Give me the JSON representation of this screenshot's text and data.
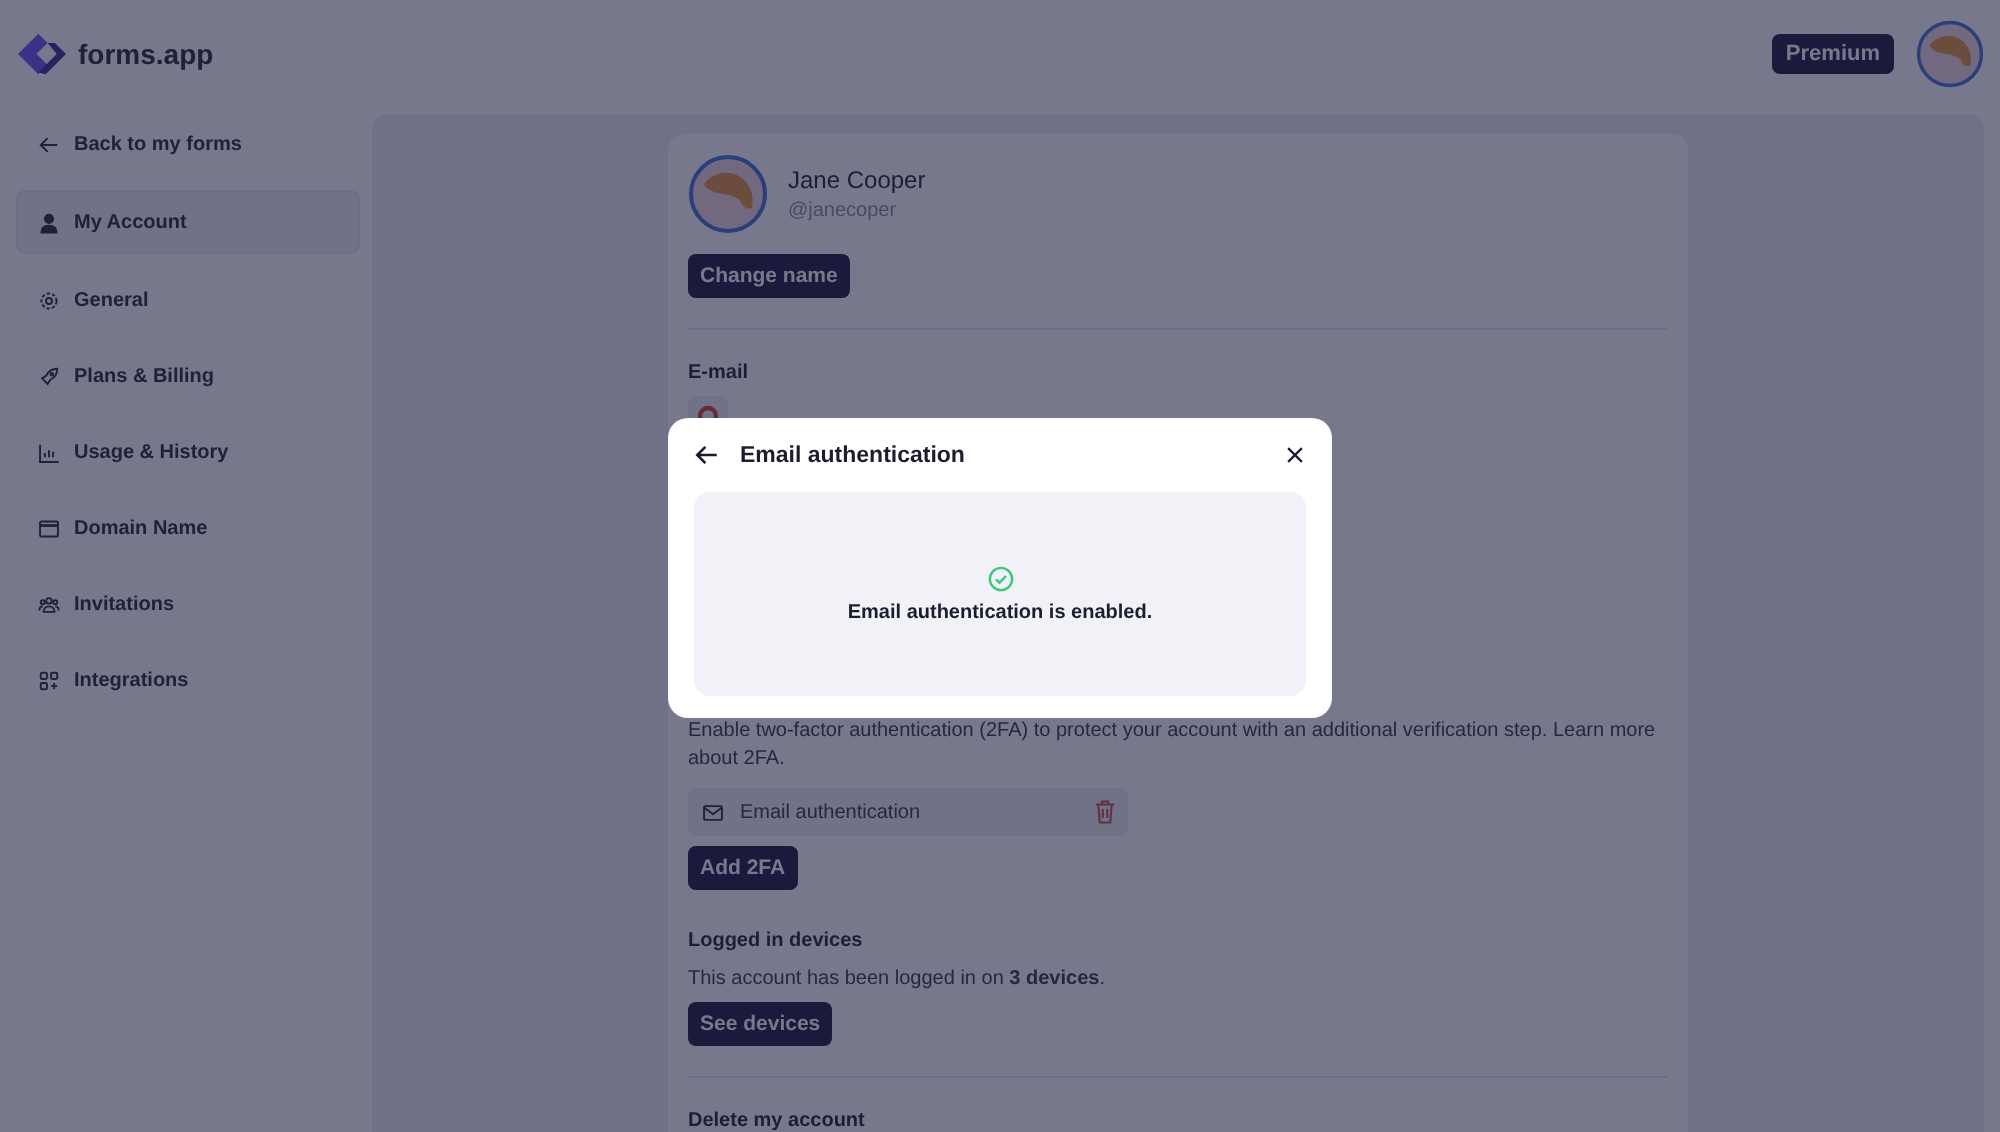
{
  "header": {
    "logo": "forms.app",
    "plan_badge": "Premium"
  },
  "sidebar": {
    "back_link": "Back to my forms",
    "items": [
      {
        "label": "My Account",
        "kind": "person",
        "selected": true
      },
      {
        "label": "General",
        "kind": "gear",
        "selected": false
      },
      {
        "label": "Plans & Billing",
        "kind": "rocket",
        "selected": false
      },
      {
        "label": "Usage & History",
        "kind": "chart",
        "selected": false
      },
      {
        "label": "Domain Name",
        "kind": "window",
        "selected": false
      },
      {
        "label": "Invitations",
        "kind": "people",
        "selected": false
      },
      {
        "label": "Integrations",
        "kind": "grid",
        "selected": false
      }
    ]
  },
  "profile": {
    "name": "Jane Cooper",
    "handle": "@janecoper",
    "change_button": "Change name"
  },
  "email_section": {
    "label": "E-mail"
  },
  "two_factor": {
    "description": "Enable two-factor authentication (2FA) to protect your account with an additional verification step. Learn more about 2FA.",
    "methods": [
      {
        "label": "Email authentication"
      }
    ],
    "add_button": "Add 2FA"
  },
  "devices": {
    "title": "Logged in devices",
    "text": "This account has been logged in on **3 devices**.",
    "button": "See devices"
  },
  "delete_section": {
    "title": "Delete my account"
  },
  "modal": {
    "title": "Email authentication",
    "message": "Email authentication is enabled.",
    "enabled": true
  }
}
